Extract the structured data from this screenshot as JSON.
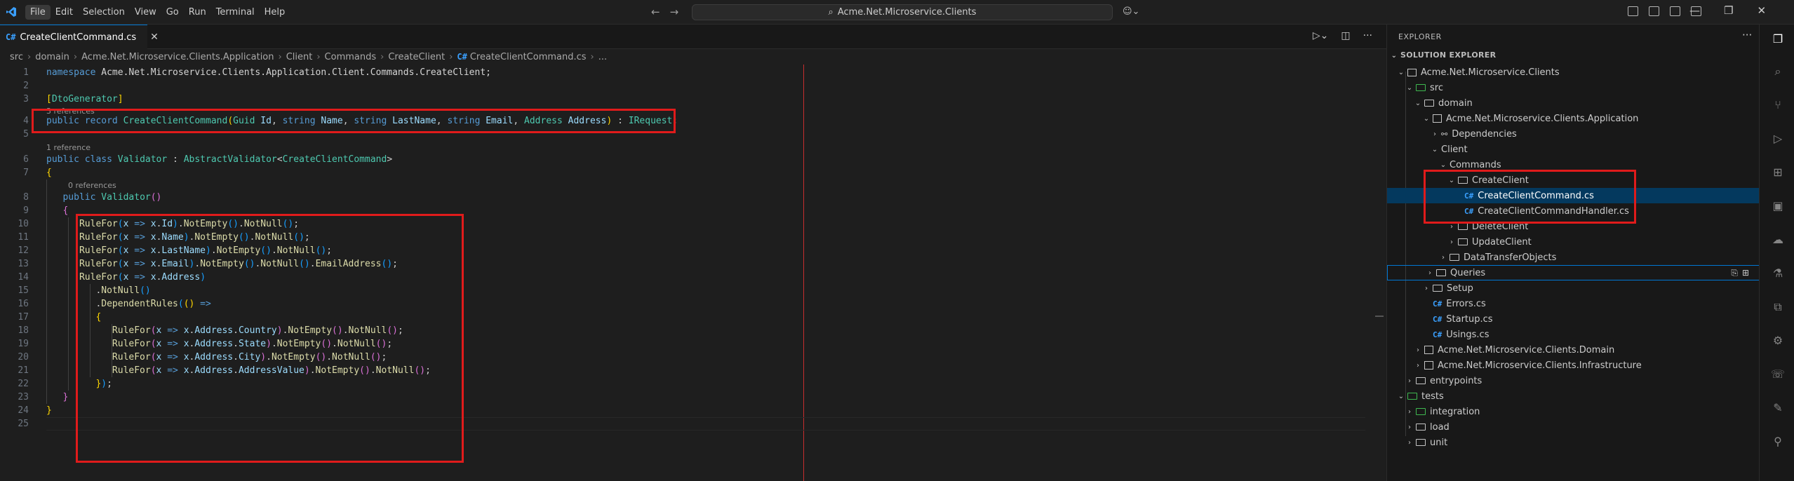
{
  "menu": {
    "items": [
      "File",
      "Edit",
      "Selection",
      "View",
      "Go",
      "Run",
      "Terminal",
      "Help"
    ]
  },
  "search": {
    "text": "Acme.Net.Microservice.Clients"
  },
  "tab": {
    "icon_text": "C#",
    "label": "CreateClientCommand.cs"
  },
  "breadcrumb": {
    "items": [
      "src",
      "domain",
      "Acme.Net.Microservice.Clients.Application",
      "Client",
      "Commands",
      "CreateClient",
      "CreateClientCommand.cs",
      "..."
    ]
  },
  "editor": {
    "line_numbers": [
      "1",
      "2",
      "3",
      "4",
      "5",
      "6",
      "7",
      "8",
      "9",
      "10",
      "11",
      "12",
      "13",
      "14",
      "15",
      "16",
      "17",
      "18",
      "19",
      "20",
      "21",
      "22",
      "23",
      "24",
      "25"
    ],
    "codelens": {
      "record_refs": "3 references",
      "class_refs": "1 reference",
      "ctor_refs": "0 references"
    },
    "tokens": {
      "namespace_kw": "namespace",
      "namespace_name": "Acme.Net.Microservice.Clients.Application.Client.Commands.CreateClient",
      "semicolon": ";",
      "attribute": "[DtoGenerator]",
      "public": "public",
      "record": "record",
      "class": "class",
      "record_name": "CreateClientCommand",
      "guid": "Guid",
      "string": "string",
      "address_type": "Address",
      "irequest": "IRequest",
      "validator": "Validator",
      "abstract_validator": "AbstractValidator",
      "rulefor": "RuleFor",
      "x": "x",
      "arrow": "=>",
      "not_empty": "NotEmpty",
      "not_null": "NotNull",
      "email_address": "EmailAddress",
      "dependent_rules": "DependentRules"
    }
  },
  "explorer": {
    "title": "EXPLORER",
    "section": "SOLUTION EXPLORER",
    "tree": [
      "Acme.Net.Microservice.Clients",
      "src",
      "domain",
      "Acme.Net.Microservice.Clients.Application",
      "Dependencies",
      "Client",
      "Commands",
      "CreateClient",
      "CreateClientCommand.cs",
      "CreateClientCommandHandler.cs",
      "DeleteClient",
      "UpdateClient",
      "DataTransferObjects",
      "Queries",
      "Setup",
      "Errors.cs",
      "Startup.cs",
      "Usings.cs",
      "Acme.Net.Microservice.Clients.Domain",
      "Acme.Net.Microservice.Clients.Infrastructure",
      "entrypoints",
      "tests",
      "integration",
      "load",
      "unit"
    ]
  },
  "colors": {
    "accent": "#0078d4",
    "highlight_box": "#e01b1b",
    "selection": "#04395e",
    "keyword": "#569cd6",
    "type": "#4ec9b0",
    "method": "#dcdcaa",
    "variable": "#9cdcfe"
  }
}
